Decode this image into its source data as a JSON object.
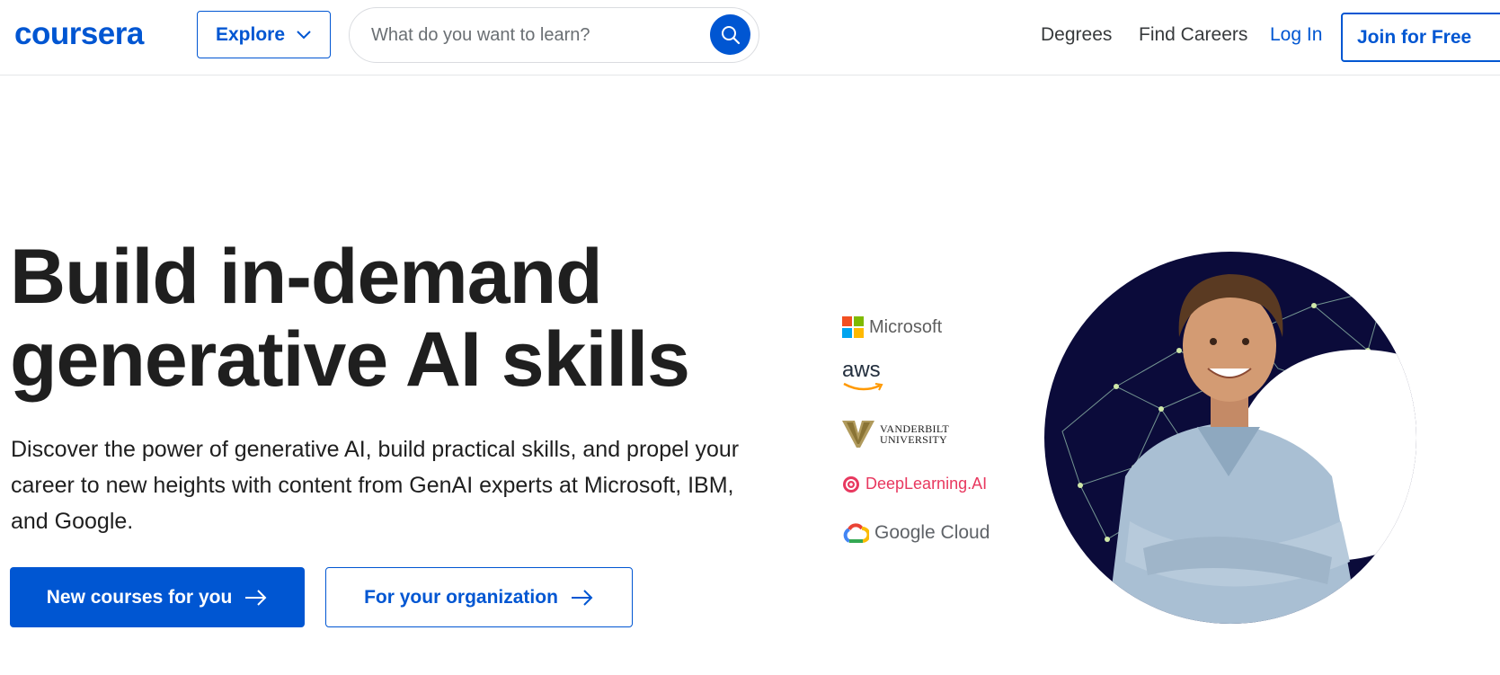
{
  "header": {
    "logo": "coursera",
    "explore_label": "Explore",
    "search_placeholder": "What do you want to learn?",
    "nav": {
      "degrees": "Degrees",
      "find_careers": "Find Careers",
      "login": "Log In",
      "join": "Join for Free"
    }
  },
  "hero": {
    "title_line1": "Build in-demand",
    "title_line2": "generative AI skills",
    "description": "Discover the power of generative AI, build practical skills, and propel your career to new heights with content from GenAI experts at Microsoft, IBM, and Google.",
    "cta_primary": "New courses for you",
    "cta_secondary": "For your organization"
  },
  "partners": {
    "microsoft": "Microsoft",
    "aws": "aws",
    "vanderbilt_line1": "VANDERBILT",
    "vanderbilt_line2": "UNIVERSITY",
    "deeplearning": "DeepLearning.AI",
    "google_cloud": "Google Cloud"
  },
  "colors": {
    "brand": "#0056d2",
    "text": "#1f1f1f",
    "muted": "#373a3c"
  },
  "icons": {
    "explore": "chevron-down-icon",
    "search": "search-icon",
    "cta": "arrow-right-icon"
  }
}
